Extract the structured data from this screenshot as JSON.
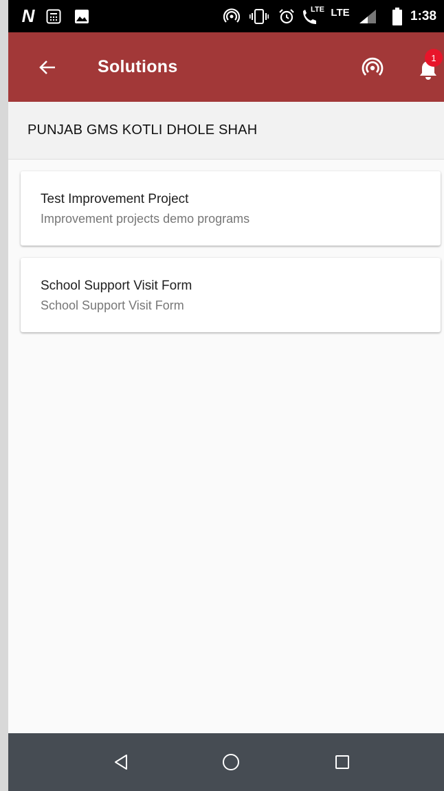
{
  "status_bar": {
    "carrier_glyph": "N",
    "network_label": "LTE",
    "volte_label": "LTE",
    "time": "1:38",
    "icons": [
      "calculator-icon",
      "image-icon",
      "hotspot-icon",
      "vibrate-icon",
      "alarm-icon",
      "volte-call-icon",
      "signal-icon",
      "battery-icon"
    ]
  },
  "app_bar": {
    "title": "Solutions",
    "notification_count": "1",
    "icons": [
      "back-arrow-icon",
      "broadcast-icon",
      "bell-icon"
    ]
  },
  "entity": {
    "name": "PUNJAB GMS KOTLI DHOLE SHAH"
  },
  "solutions": [
    {
      "title": "Test Improvement Project",
      "subtitle": "Improvement projects demo programs"
    },
    {
      "title": "School Support Visit Form",
      "subtitle": "School Support Visit Form"
    }
  ],
  "nav_bar": {
    "icons": [
      "nav-back-icon",
      "nav-home-icon",
      "nav-recent-icon"
    ]
  },
  "colors": {
    "app_bar": "#a23838",
    "badge": "#e8152a",
    "nav_bar": "#464c53",
    "status_bar": "#000000",
    "background": "#fafafa"
  }
}
